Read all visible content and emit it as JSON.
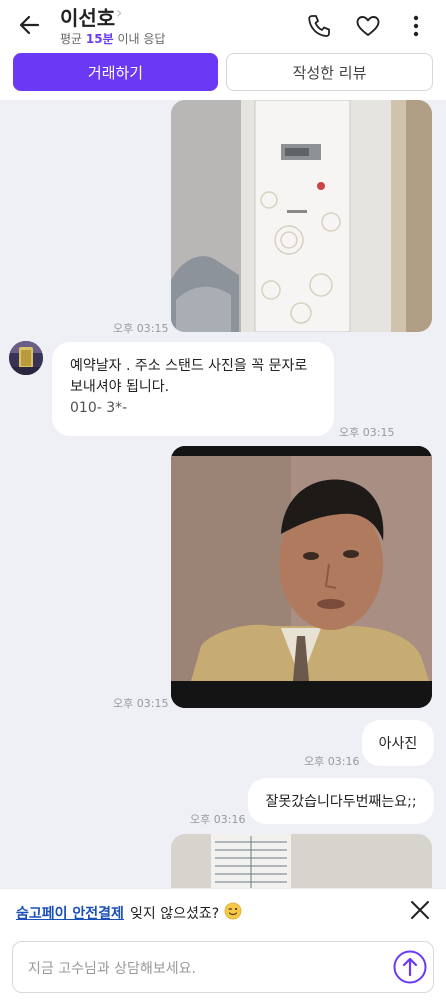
{
  "header": {
    "title": "이선호",
    "subtitle_prefix": "평균",
    "subtitle_highlight": "15분",
    "subtitle_suffix": "이내 응답",
    "deal_button": "거래하기",
    "review_button": "작성한 리뷰"
  },
  "messages": {
    "m1_time": "오후 03:15",
    "m2_line1": "예약날자 . 주소  스탠드 사진을 꼭 문자로",
    "m2_line2": "보내셔야 됩니다.",
    "m2_line3": "010-  3*-   ",
    "m2_time": "오후 03:15",
    "m3_time": "오후 03:15",
    "m4_text": "아사진",
    "m4_time": "오후 03:16",
    "m5_text": "잘못갔습니다두번째는요;;",
    "m5_time": "오후 03:16"
  },
  "banner": {
    "link": "숨고페이 안전결제",
    "text": "잊지 않으셨죠?"
  },
  "composer": {
    "placeholder": "지금 고수님과 상담해보세요."
  },
  "colors": {
    "accent": "#6b38f5",
    "link": "#1a4fb8",
    "background": "#eef0f5"
  }
}
